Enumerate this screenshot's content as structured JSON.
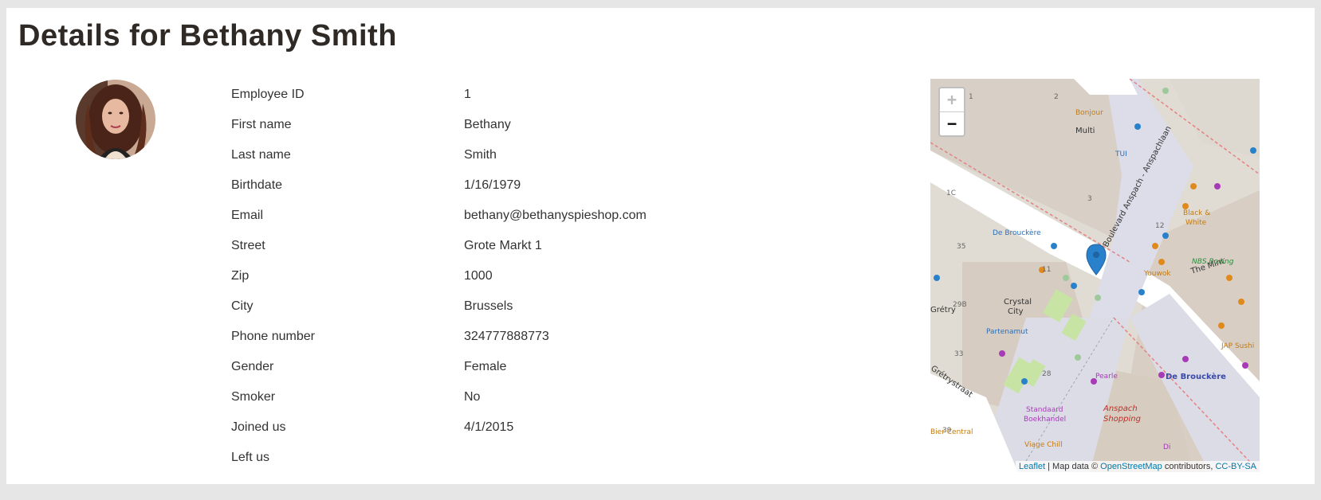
{
  "page": {
    "title": "Details for Bethany Smith"
  },
  "employee": {
    "rows": [
      {
        "label": "Employee ID",
        "value": "1"
      },
      {
        "label": "First name",
        "value": "Bethany"
      },
      {
        "label": "Last name",
        "value": "Smith"
      },
      {
        "label": "Birthdate",
        "value": "1/16/1979"
      },
      {
        "label": "Email",
        "value": "bethany@bethanyspieshop.com"
      },
      {
        "label": "Street",
        "value": "Grote Markt 1"
      },
      {
        "label": "Zip",
        "value": "1000"
      },
      {
        "label": "City",
        "value": "Brussels"
      },
      {
        "label": "Phone number",
        "value": "324777888773"
      },
      {
        "label": "Gender",
        "value": "Female"
      },
      {
        "label": "Smoker",
        "value": "No"
      },
      {
        "label": "Joined us",
        "value": "4/1/2015"
      },
      {
        "label": "Left us",
        "value": ""
      }
    ]
  },
  "map": {
    "zoom_in": "+",
    "zoom_out": "−",
    "attribution": {
      "leaflet": "Leaflet",
      "sep1": " | Map data © ",
      "osm": "OpenStreetMap",
      "sep2": " contributors, ",
      "license": "CC-BY-SA"
    },
    "labels": {
      "bonjour": "Bonjour",
      "multi": "Multi",
      "tui": "TUI",
      "boulevard": "Boulevard Anspach - Anspachlaan",
      "debrouckere_stop": "De Brouckère",
      "debrouckere_square": "De Brouckère",
      "black": "Black &",
      "white": "White",
      "nbs": "NBS Boxing",
      "youwok": "Youwok",
      "mint": "The Mint",
      "crystal": "Crystal",
      "city": "City",
      "partenamut": "Partenamut",
      "gretry": "Grétry",
      "gretrystraat": "Grétrystraat",
      "pearle": "Pearle",
      "anspach": "Anspach",
      "shopping": "Shopping",
      "standaard": "Standaard",
      "boekhandel": "Boekhandel",
      "viage": "Viage Chill",
      "bier": "Bier Central",
      "jap": "JAP Sushi",
      "di": "Di",
      "n29b": "29B",
      "n35": "35",
      "n33": "33",
      "n39": "39",
      "n28": "28",
      "n11": "11",
      "n12": "12",
      "n1c": "1C",
      "n2": "2",
      "n3": "3",
      "n1": "1"
    }
  },
  "colors": {
    "marker": "#2a81cb",
    "background": "#e6e6e6"
  }
}
